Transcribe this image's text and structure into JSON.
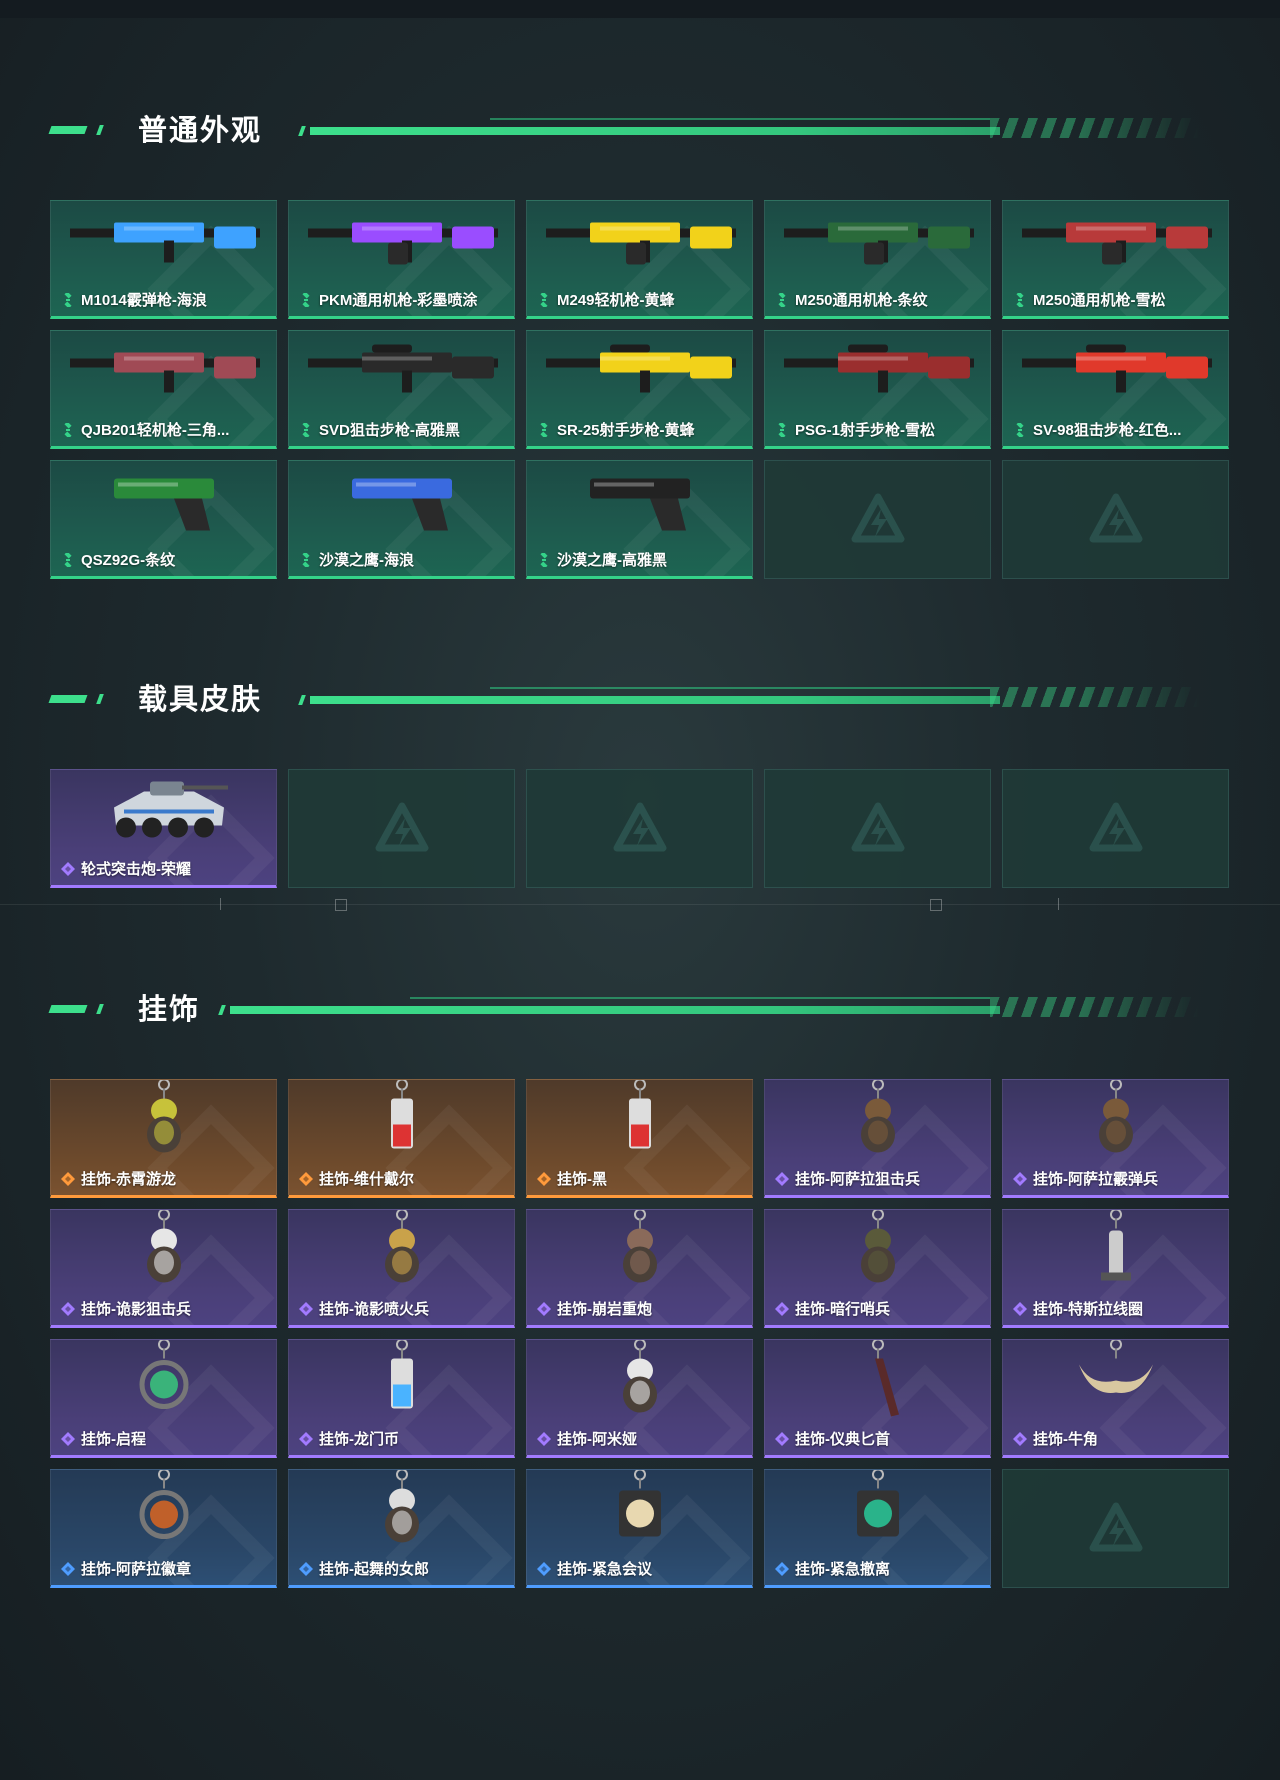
{
  "sections": {
    "normal_skins": {
      "title": "普通外观",
      "items": [
        {
          "name": "M1014霰弹枪-海浪",
          "rarity": "green",
          "icon": "shotgun-icon",
          "accent": "#3ea2ff"
        },
        {
          "name": "PKM通用机枪-彩墨喷涂",
          "rarity": "green",
          "icon": "machine-gun-icon",
          "accent": "#9a4dff"
        },
        {
          "name": "M249轻机枪-黄蜂",
          "rarity": "green",
          "icon": "machine-gun-icon",
          "accent": "#f2d21a"
        },
        {
          "name": "M250通用机枪-条纹",
          "rarity": "green",
          "icon": "machine-gun-icon",
          "accent": "#2a6a3a"
        },
        {
          "name": "M250通用机枪-雪松",
          "rarity": "green",
          "icon": "machine-gun-icon",
          "accent": "#b83a3a"
        },
        {
          "name": "QJB201轻机枪-三角...",
          "rarity": "green",
          "icon": "rifle-icon",
          "accent": "#a04a55"
        },
        {
          "name": "SVD狙击步枪-高雅黑",
          "rarity": "green",
          "icon": "sniper-icon",
          "accent": "#2a2a2a"
        },
        {
          "name": "SR-25射手步枪-黄蜂",
          "rarity": "green",
          "icon": "sniper-icon",
          "accent": "#f2d21a"
        },
        {
          "name": "PSG-1射手步枪-雪松",
          "rarity": "green",
          "icon": "sniper-icon",
          "accent": "#9a2e2e"
        },
        {
          "name": "SV-98狙击步枪-红色...",
          "rarity": "green",
          "icon": "sniper-icon",
          "accent": "#e0392b"
        },
        {
          "name": "QSZ92G-条纹",
          "rarity": "green",
          "icon": "pistol-icon",
          "accent": "#2a8a3a"
        },
        {
          "name": "沙漠之鹰-海浪",
          "rarity": "green",
          "icon": "pistol-icon",
          "accent": "#3a6adf"
        },
        {
          "name": "沙漠之鹰-高雅黑",
          "rarity": "green",
          "icon": "pistol-icon",
          "accent": "#222222"
        },
        {
          "name": "",
          "rarity": "empty",
          "icon": "placeholder-logo-icon"
        },
        {
          "name": "",
          "rarity": "empty",
          "icon": "placeholder-logo-icon"
        }
      ]
    },
    "vehicle_skins": {
      "title": "载具皮肤",
      "items": [
        {
          "name": "轮式突击炮-荣耀",
          "rarity": "purple",
          "icon": "armored-vehicle-icon",
          "accent": "#cfd6dd"
        },
        {
          "name": "",
          "rarity": "empty",
          "icon": "placeholder-logo-icon"
        },
        {
          "name": "",
          "rarity": "empty",
          "icon": "placeholder-logo-icon"
        },
        {
          "name": "",
          "rarity": "empty",
          "icon": "placeholder-logo-icon"
        },
        {
          "name": "",
          "rarity": "empty",
          "icon": "placeholder-logo-icon"
        }
      ]
    },
    "charms": {
      "title": "挂饰",
      "items": [
        {
          "name": "挂饰-赤霄游龙",
          "rarity": "orange",
          "icon": "charm-dragon-icon",
          "accent": "#c7c23a"
        },
        {
          "name": "挂饰-维什戴尔",
          "rarity": "orange",
          "icon": "charm-card-icon",
          "accent": "#d33"
        },
        {
          "name": "挂饰-黑",
          "rarity": "orange",
          "icon": "charm-card-icon",
          "accent": "#d33"
        },
        {
          "name": "挂饰-阿萨拉狙击兵",
          "rarity": "purple",
          "icon": "charm-soldier-icon",
          "accent": "#7a5a3a"
        },
        {
          "name": "挂饰-阿萨拉霰弹兵",
          "rarity": "purple",
          "icon": "charm-soldier-icon",
          "accent": "#7a5a3a"
        },
        {
          "name": "挂饰-诡影狙击兵",
          "rarity": "purple",
          "icon": "charm-bird-icon",
          "accent": "#e6e6e6"
        },
        {
          "name": "挂饰-诡影喷火兵",
          "rarity": "purple",
          "icon": "charm-figure-icon",
          "accent": "#c9a24a"
        },
        {
          "name": "挂饰-崩岩重炮",
          "rarity": "purple",
          "icon": "charm-figure-icon",
          "accent": "#8a6a5a"
        },
        {
          "name": "挂饰-暗行哨兵",
          "rarity": "purple",
          "icon": "charm-figure-icon",
          "accent": "#5a5a3a"
        },
        {
          "name": "挂饰-特斯拉线圈",
          "rarity": "purple",
          "icon": "charm-coil-icon",
          "accent": "#cccccc"
        },
        {
          "name": "挂饰-启程",
          "rarity": "purple",
          "icon": "charm-medal-icon",
          "accent": "#3ab37a"
        },
        {
          "name": "挂饰-龙门币",
          "rarity": "purple",
          "icon": "charm-bottle-icon",
          "accent": "#4ab3ff"
        },
        {
          "name": "挂饰-阿米娅",
          "rarity": "purple",
          "icon": "charm-bunny-icon",
          "accent": "#e6e6e6"
        },
        {
          "name": "挂饰-仪典匕首",
          "rarity": "purple",
          "icon": "charm-dagger-icon",
          "accent": "#5a2a2a"
        },
        {
          "name": "挂饰-牛角",
          "rarity": "purple",
          "icon": "charm-horn-icon",
          "accent": "#d8c7a0"
        },
        {
          "name": "挂饰-阿萨拉徽章",
          "rarity": "blue",
          "icon": "charm-badge-icon",
          "accent": "#c0602a"
        },
        {
          "name": "挂饰-起舞的女郎",
          "rarity": "blue",
          "icon": "charm-dancer-icon",
          "accent": "#dddddd"
        },
        {
          "name": "挂饰-紧急会议",
          "rarity": "blue",
          "icon": "charm-meeting-icon",
          "accent": "#e8d8b0"
        },
        {
          "name": "挂饰-紧急撤离",
          "rarity": "blue",
          "icon": "charm-exit-icon",
          "accent": "#2ab38a"
        },
        {
          "name": "",
          "rarity": "empty",
          "icon": "placeholder-logo-icon"
        }
      ]
    }
  },
  "rarity_colors": {
    "green": "#34d389",
    "purple": "#a27bff",
    "orange": "#ff9a3c",
    "blue": "#4f9dff"
  }
}
